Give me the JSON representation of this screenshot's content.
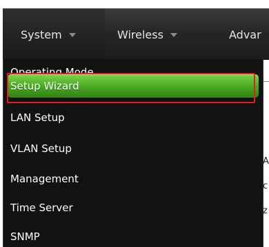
{
  "navbar": {
    "items": [
      {
        "label": "System",
        "icon": "chevron-down-icon"
      },
      {
        "label": "Wireless",
        "icon": "chevron-down-icon"
      },
      {
        "label": "Advar"
      }
    ]
  },
  "dropdown": {
    "items": [
      {
        "label": "Operating Mode"
      },
      {
        "label": "Setup Wizard",
        "highlighted": true
      },
      {
        "label": "LAN Setup"
      },
      {
        "label": "VLAN Setup"
      },
      {
        "label": "Management"
      },
      {
        "label": "Time Server"
      },
      {
        "label": "SNMP"
      }
    ]
  },
  "page_edge": {
    "glyphs": [
      "A",
      "c",
      "z"
    ]
  },
  "colors": {
    "navbar": "#262626",
    "menu_bg": "#121212",
    "highlight_green": "#4fae27",
    "focus_red": "#e02020"
  }
}
